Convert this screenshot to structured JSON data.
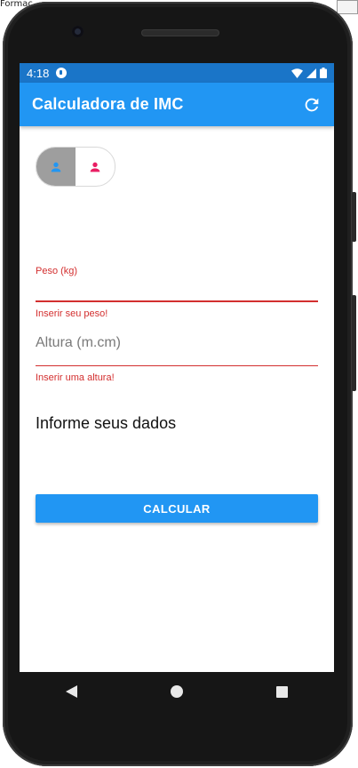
{
  "desktop": {
    "label": "Formac"
  },
  "status_bar": {
    "time": "4:18"
  },
  "app_bar": {
    "title": "Calculadora de IMC",
    "refresh_icon": "refresh-icon"
  },
  "gender": {
    "options": [
      {
        "icon": "person-icon",
        "color": "#2196f3",
        "selected": true
      },
      {
        "icon": "person-icon",
        "color": "#e91e63",
        "selected": false
      }
    ]
  },
  "form": {
    "weight": {
      "label": "Peso (kg)",
      "value": "",
      "error": "Inserir seu peso!"
    },
    "height": {
      "placeholder": "Altura (m.cm)",
      "value": "",
      "error": "Inserir uma altura!"
    }
  },
  "info": "Informe seus dados",
  "calculate_button": "CALCULAR",
  "colors": {
    "primary": "#2196f3",
    "status_bar": "#1a75c8",
    "error": "#d32f2f",
    "accent_female": "#e91e63"
  }
}
